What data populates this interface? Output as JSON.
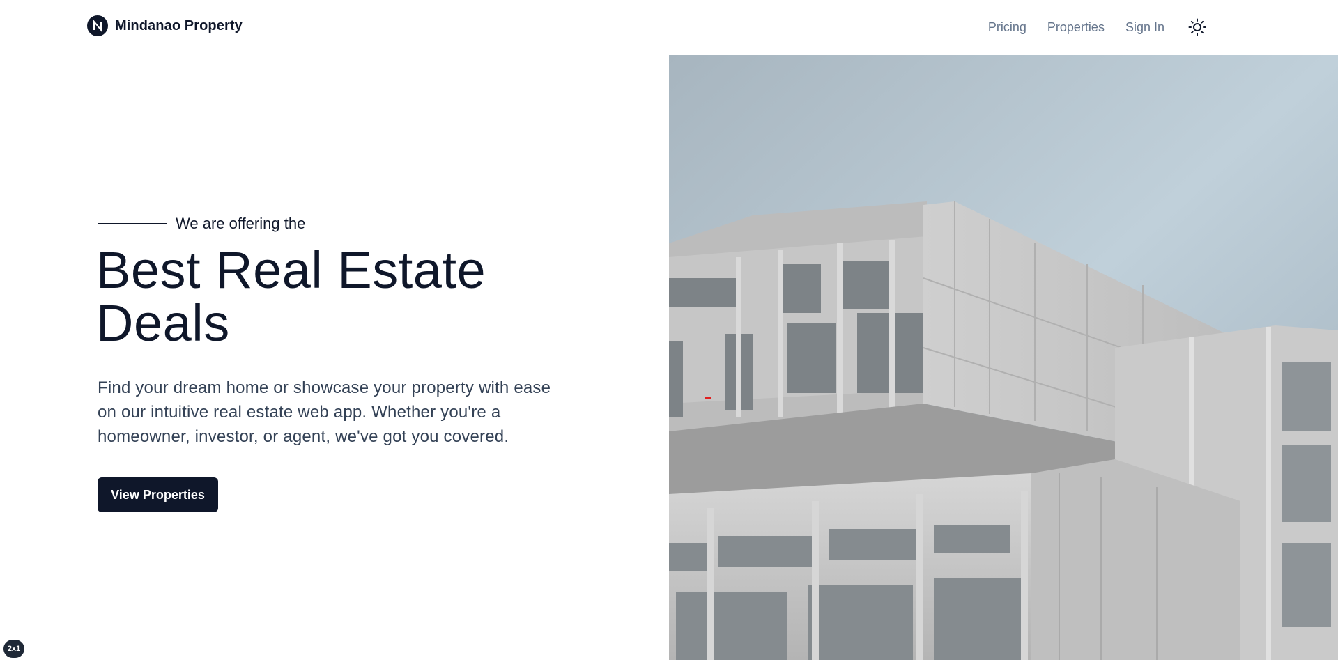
{
  "header": {
    "brand_name": "Mindanao Property",
    "logo_icon": "n-logo-icon",
    "nav": [
      {
        "label": "Pricing"
      },
      {
        "label": "Properties"
      },
      {
        "label": "Sign In"
      }
    ],
    "theme_icon": "sun-icon"
  },
  "hero": {
    "eyebrow": "We are offering the",
    "title": "Best Real Estate Deals",
    "description": "Find your dream home or showcase your property with ease on our intuitive real estate web app. Whether you're a homeowner, investor, or agent, we've got you covered.",
    "cta_label": "View Properties",
    "image_subject": "modern-building-photo"
  },
  "badge": "2x1",
  "colors": {
    "primary": "#0f172a",
    "nav_text": "#64748b",
    "body_text": "#334155",
    "sky": "#b7c6d1",
    "building": "#d2d2d2"
  }
}
